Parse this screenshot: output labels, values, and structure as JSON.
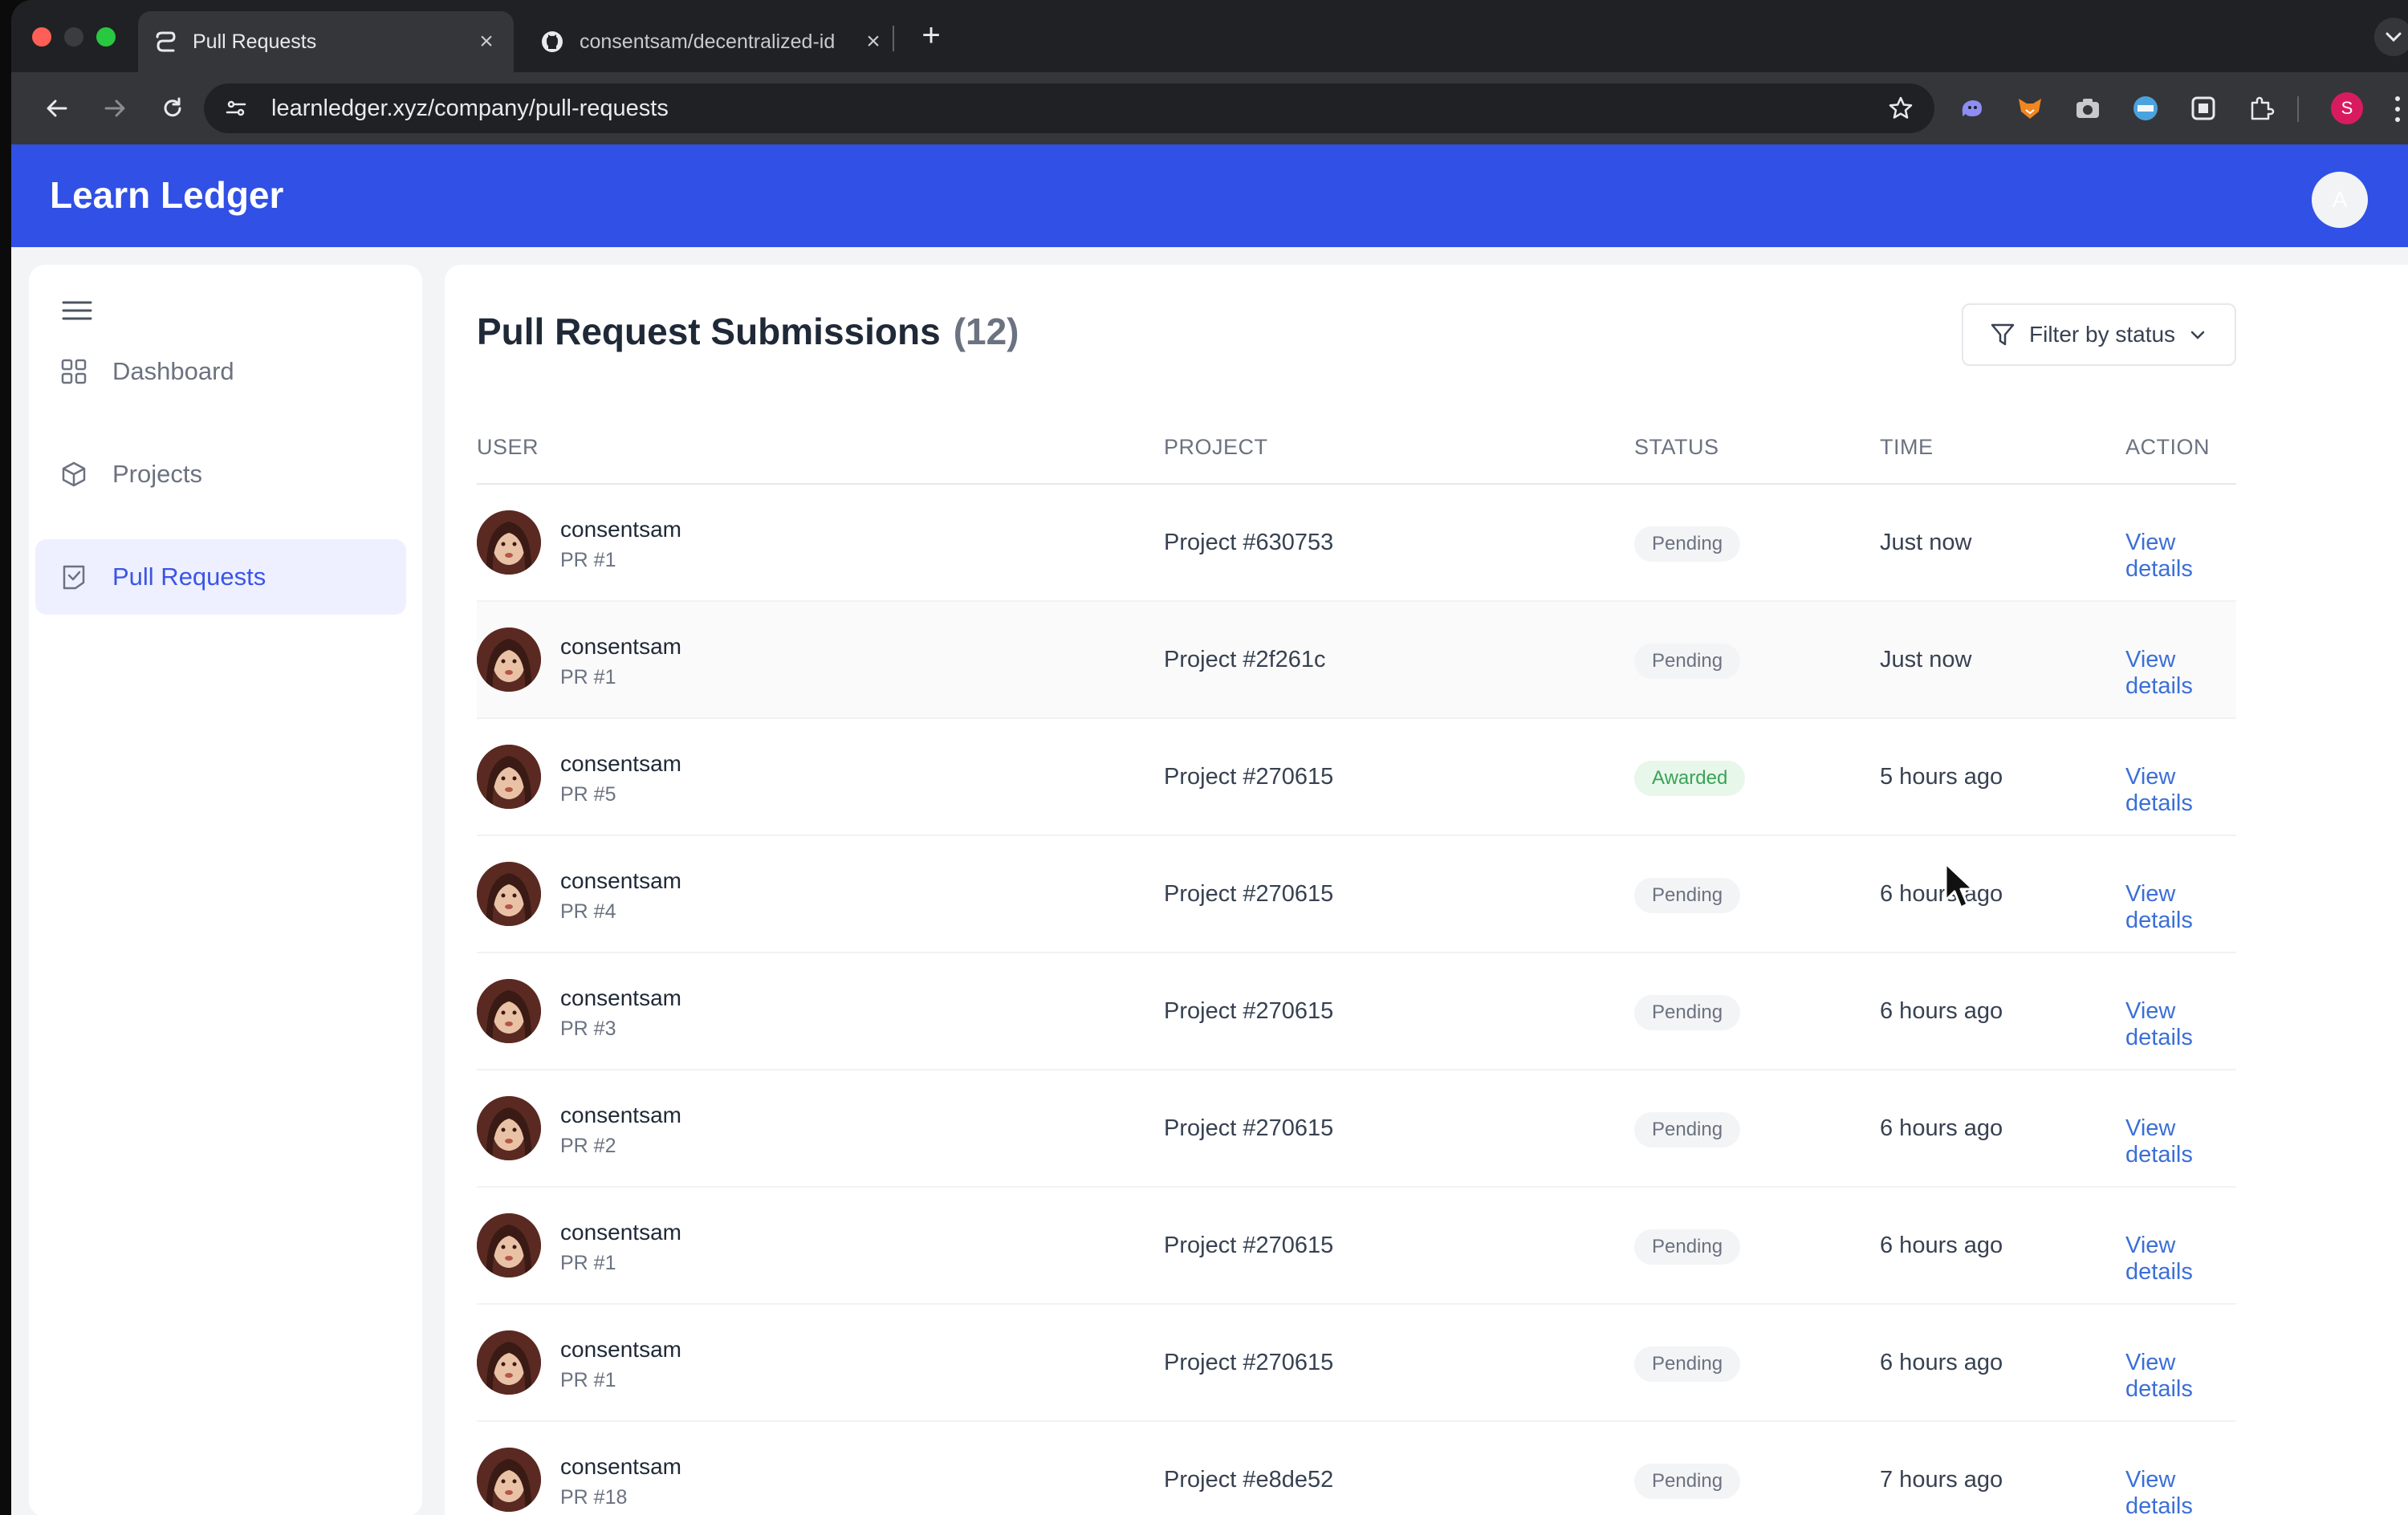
{
  "browser": {
    "tabs": [
      {
        "title": "Pull Requests",
        "icon": "learnledger-favicon-icon",
        "active": true
      },
      {
        "title": "consentsam/decentralized-id",
        "icon": "github-icon",
        "active": false
      }
    ],
    "new_tab_label": "+",
    "url": "learnledger.xyz/company/pull-requests",
    "profile_initial": "S"
  },
  "app": {
    "brand": "Learn Ledger",
    "user_initial": "A",
    "accent_color": "#3050e6"
  },
  "sidebar": {
    "items": [
      {
        "label": "Dashboard",
        "icon": "grid-icon",
        "active": false
      },
      {
        "label": "Projects",
        "icon": "cube-icon",
        "active": false
      },
      {
        "label": "Pull Requests",
        "icon": "pr-icon",
        "active": true
      }
    ]
  },
  "main": {
    "title": "Pull Request Submissions",
    "count": "(12)",
    "filter_label": "Filter by status",
    "columns": [
      "USER",
      "PROJECT",
      "STATUS",
      "TIME",
      "ACTION"
    ],
    "rows": [
      {
        "user": "consentsam",
        "pr": "PR #1",
        "project": "Project #630753",
        "status": "Pending",
        "time": "Just now",
        "action": "View details"
      },
      {
        "user": "consentsam",
        "pr": "PR #1",
        "project": "Project #2f261c",
        "status": "Pending",
        "time": "Just now",
        "action": "View details"
      },
      {
        "user": "consentsam",
        "pr": "PR #5",
        "project": "Project #270615",
        "status": "Awarded",
        "time": "5 hours ago",
        "action": "View details"
      },
      {
        "user": "consentsam",
        "pr": "PR #4",
        "project": "Project #270615",
        "status": "Pending",
        "time": "6 hours ago",
        "action": "View details"
      },
      {
        "user": "consentsam",
        "pr": "PR #3",
        "project": "Project #270615",
        "status": "Pending",
        "time": "6 hours ago",
        "action": "View details"
      },
      {
        "user": "consentsam",
        "pr": "PR #2",
        "project": "Project #270615",
        "status": "Pending",
        "time": "6 hours ago",
        "action": "View details"
      },
      {
        "user": "consentsam",
        "pr": "PR #1",
        "project": "Project #270615",
        "status": "Pending",
        "time": "6 hours ago",
        "action": "View details"
      },
      {
        "user": "consentsam",
        "pr": "PR #1",
        "project": "Project #270615",
        "status": "Pending",
        "time": "6 hours ago",
        "action": "View details"
      },
      {
        "user": "consentsam",
        "pr": "PR #18",
        "project": "Project #e8de52",
        "status": "Pending",
        "time": "7 hours ago",
        "action": "View details"
      }
    ]
  }
}
